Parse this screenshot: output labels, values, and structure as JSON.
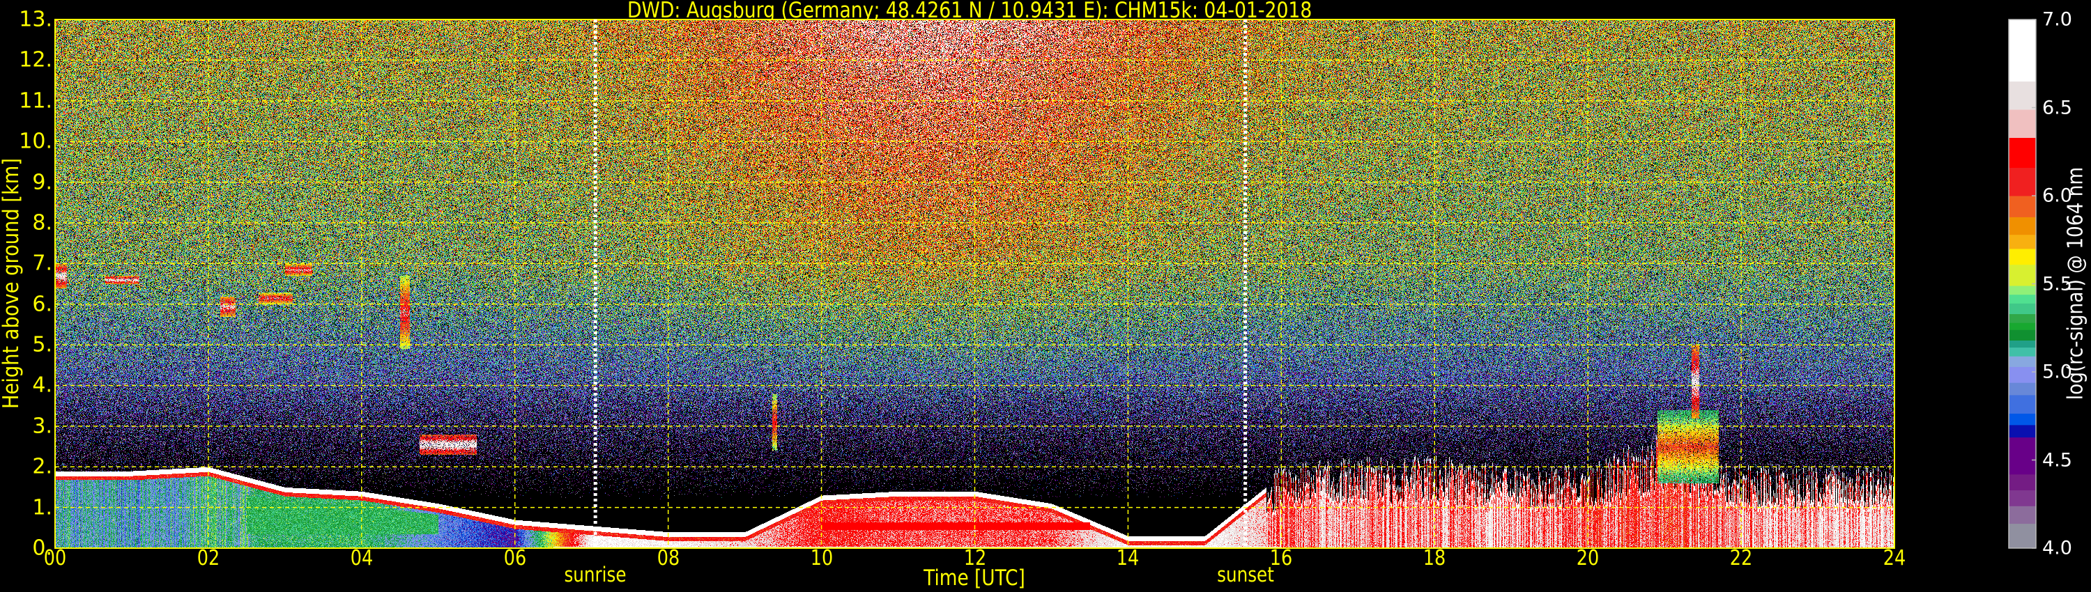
{
  "chart_data": {
    "type": "heatmap",
    "title": "DWD: Augsburg (Germany; 48.4261 N / 10.9431 E):    CHM15k: 04-01-2018",
    "xlabel": "Time [UTC]",
    "ylabel": "Height above ground [km]",
    "colorbar_label": "log(rc-signal) @ 1064 nm",
    "xlim": [
      0,
      24
    ],
    "ylim": [
      0,
      13
    ],
    "clim": [
      4.0,
      7.0
    ],
    "grid": true,
    "x_ticks": [
      0,
      2,
      4,
      6,
      8,
      10,
      12,
      14,
      16,
      18,
      20,
      22,
      24
    ],
    "x_tick_labels": [
      "00",
      "02",
      "04",
      "06",
      "08",
      "10",
      "12",
      "14",
      "16",
      "18",
      "20",
      "22",
      "24"
    ],
    "y_ticks": [
      0,
      1,
      2,
      3,
      4,
      5,
      6,
      7,
      8,
      9,
      10,
      11,
      12,
      13
    ],
    "y_tick_labels": [
      "0.",
      "1.",
      "2.",
      "3.",
      "4.",
      "5.",
      "6.",
      "7.",
      "8.",
      "9.",
      "10.",
      "11.",
      "12.",
      "13."
    ],
    "colorbar_ticks": [
      4.0,
      4.5,
      5.0,
      5.5,
      6.0,
      6.5,
      7.0
    ],
    "colorbar_tick_labels": [
      "4.0",
      "4.5",
      "5.0",
      "5.5",
      "6.0",
      "6.5",
      "7.0"
    ],
    "colorscale": [
      [
        4.0,
        "#9090a0"
      ],
      [
        4.14,
        "#8c6c9c"
      ],
      [
        4.24,
        "#803890"
      ],
      [
        4.33,
        "#741c84"
      ],
      [
        4.42,
        "#680088"
      ],
      [
        4.63,
        "#0a10b0"
      ],
      [
        4.7,
        "#0058e8"
      ],
      [
        4.765,
        "#4070e0"
      ],
      [
        4.87,
        "#6888d8"
      ],
      [
        4.94,
        "#8890f0"
      ],
      [
        5.03,
        "#88a8e0"
      ],
      [
        5.09,
        "#40c0a8"
      ],
      [
        5.14,
        "#20a088"
      ],
      [
        5.18,
        "#109030"
      ],
      [
        5.24,
        "#18a830"
      ],
      [
        5.28,
        "#30a848"
      ],
      [
        5.33,
        "#40c888"
      ],
      [
        5.39,
        "#50e090"
      ],
      [
        5.44,
        "#90f078"
      ],
      [
        5.49,
        "#d8f030"
      ],
      [
        5.61,
        "#ffee00"
      ],
      [
        5.7,
        "#f8b010"
      ],
      [
        5.78,
        "#f09000"
      ],
      [
        5.88,
        "#f06020"
      ],
      [
        6.0,
        "#f02020"
      ],
      [
        6.16,
        "#ff0000"
      ],
      [
        6.33,
        "#f0c0c0"
      ],
      [
        6.49,
        "#e8e0e0"
      ],
      [
        6.65,
        "#ffffff"
      ]
    ],
    "sun_events": [
      {
        "label": "sunrise",
        "time_utc": 7.05
      },
      {
        "label": "sunset",
        "time_utc": 15.53
      }
    ],
    "boundary_layer": {
      "hours": [
        0,
        1,
        2,
        3,
        4,
        5,
        6,
        7,
        8,
        9,
        10,
        11,
        12,
        13,
        14,
        15,
        16,
        17,
        18,
        19,
        20,
        21,
        22,
        23,
        24
      ],
      "top_km": [
        1.9,
        1.9,
        2.0,
        1.5,
        1.4,
        1.1,
        0.7,
        0.55,
        0.4,
        0.4,
        1.3,
        1.4,
        1.4,
        1.1,
        0.3,
        0.3,
        1.8,
        2.0,
        2.0,
        1.8,
        1.8,
        2.6,
        1.8,
        1.8,
        1.8
      ],
      "signal": [
        5.1,
        5.0,
        5.2,
        5.25,
        5.3,
        4.9,
        4.6,
        6.7,
        6.7,
        6.5,
        6.2,
        6.3,
        6.3,
        6.3,
        6.7,
        6.7,
        6.4,
        6.4,
        6.4,
        6.5,
        6.3,
        6.2,
        6.4,
        6.5,
        6.5
      ]
    },
    "cloud_layers": [
      {
        "t0": 0.0,
        "t1": 0.15,
        "h0": 6.4,
        "h1": 7.0,
        "signal": 6.6
      },
      {
        "t0": 0.65,
        "t1": 1.1,
        "h0": 6.5,
        "h1": 6.7,
        "signal": 6.6
      },
      {
        "t0": 2.15,
        "t1": 2.35,
        "h0": 5.7,
        "h1": 6.2,
        "signal": 6.5
      },
      {
        "t0": 2.65,
        "t1": 3.1,
        "h0": 6.0,
        "h1": 6.3,
        "signal": 6.3
      },
      {
        "t0": 3.0,
        "t1": 3.35,
        "h0": 6.7,
        "h1": 7.0,
        "signal": 6.4
      },
      {
        "t0": 4.5,
        "t1": 4.62,
        "h0": 4.9,
        "h1": 6.7,
        "signal": 6.3
      },
      {
        "t0": 4.75,
        "t1": 5.5,
        "h0": 2.3,
        "h1": 2.8,
        "signal": 6.7
      },
      {
        "t0": 9.35,
        "t1": 9.42,
        "h0": 2.4,
        "h1": 3.8,
        "signal": 6.2
      },
      {
        "t0": 20.9,
        "t1": 21.7,
        "h0": 1.6,
        "h1": 3.4,
        "signal": 6.0
      },
      {
        "t0": 21.35,
        "t1": 21.45,
        "h0": 3.2,
        "h1": 5.0,
        "signal": 6.6
      }
    ]
  }
}
